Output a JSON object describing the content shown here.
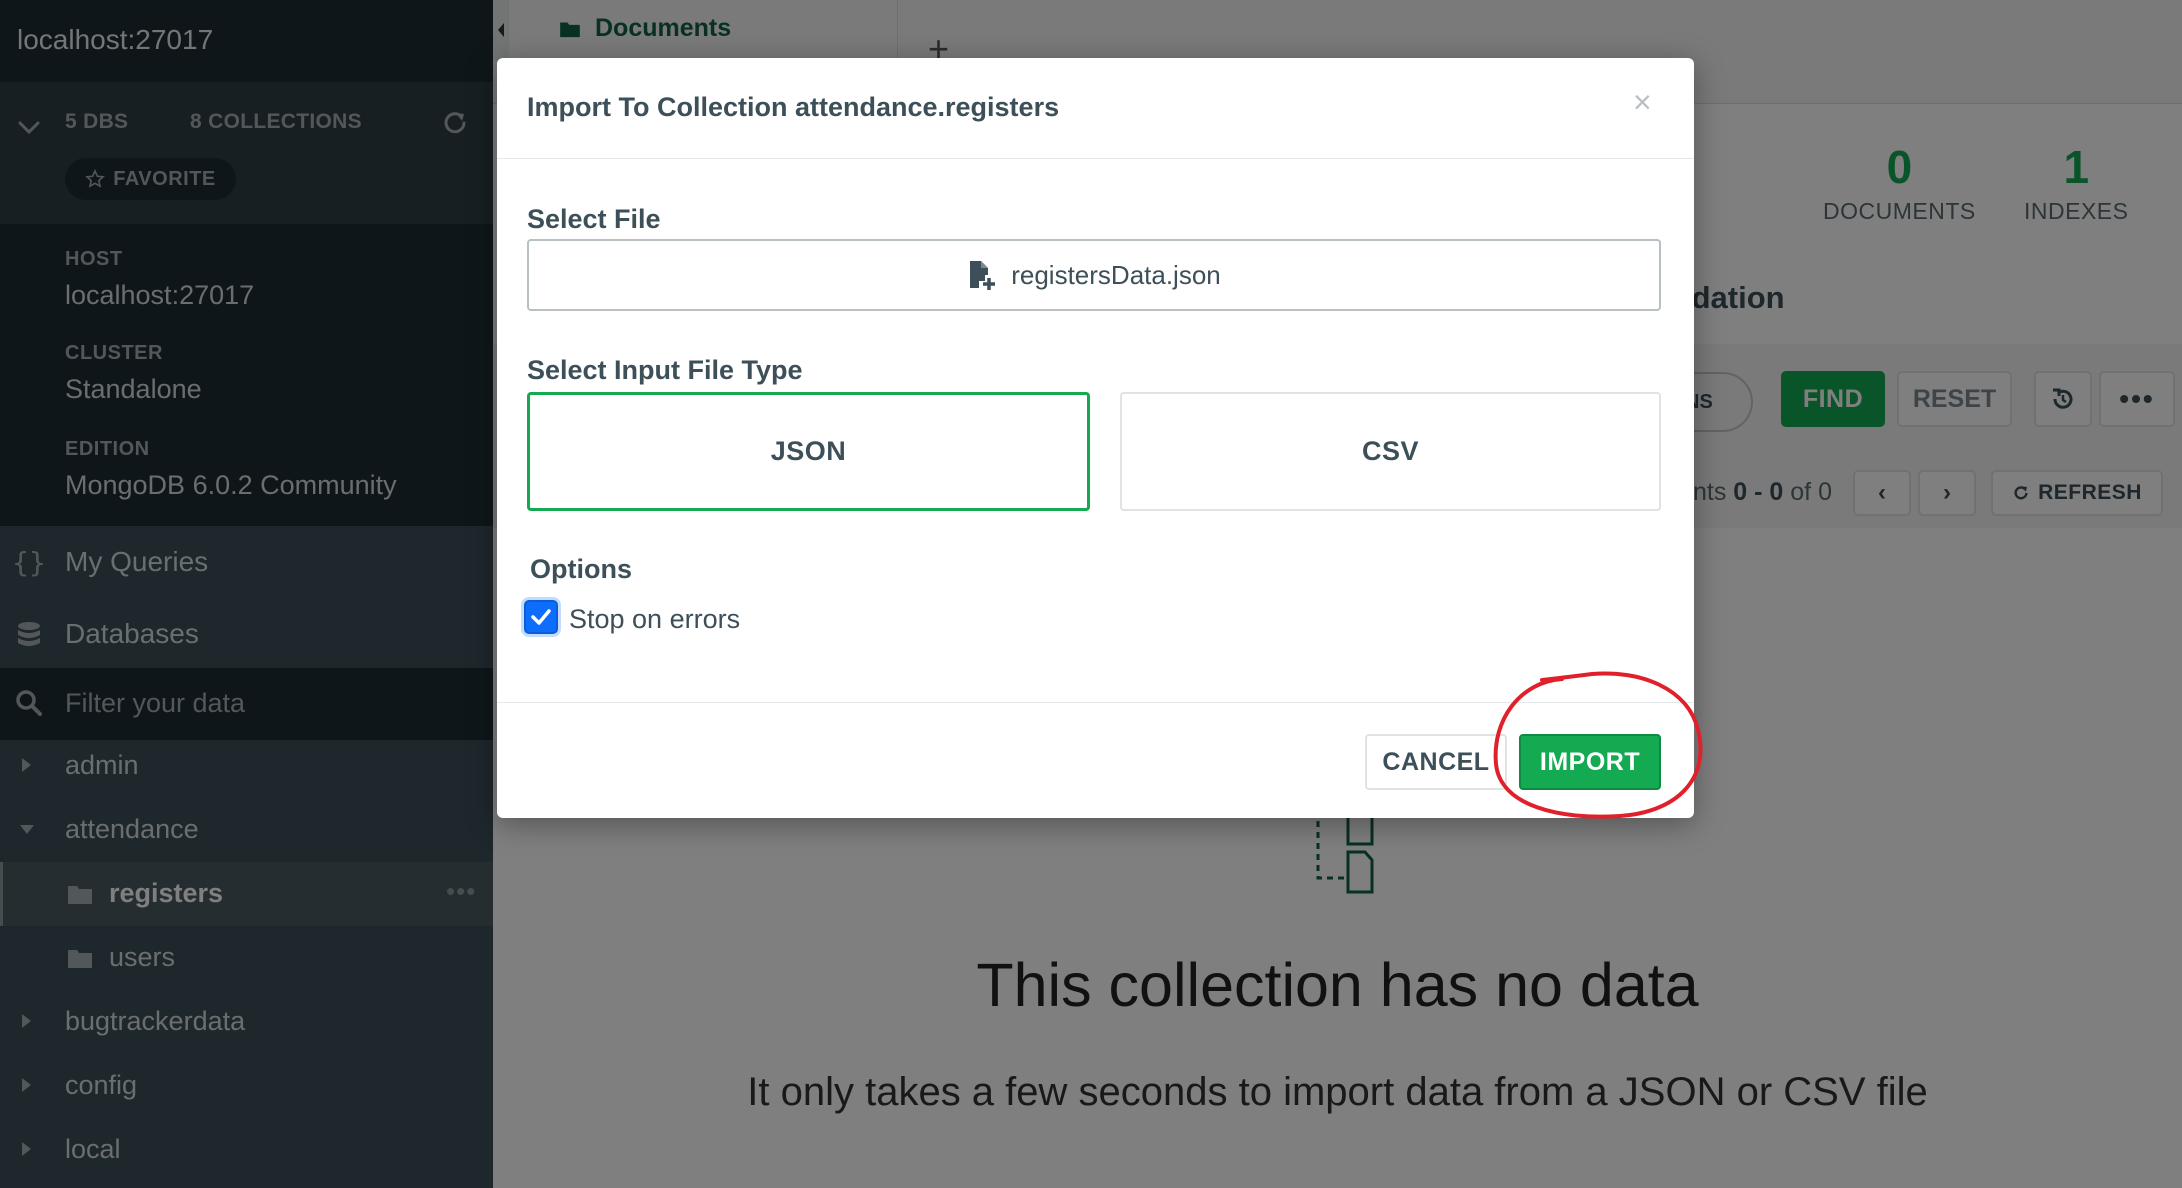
{
  "sidebar": {
    "connection": "localhost:27017",
    "dbs_count": "5",
    "dbs_label": "DBS",
    "collections_count": "8",
    "collections_label": "COLLECTIONS",
    "favorite_label": "FAVORITE",
    "host_label": "HOST",
    "host_value": "localhost:27017",
    "cluster_label": "CLUSTER",
    "cluster_value": "Standalone",
    "edition_label": "EDITION",
    "edition_value": "MongoDB 6.0.2 Community",
    "nav": [
      {
        "label": "My Queries",
        "icon": "braces-icon"
      },
      {
        "label": "Databases",
        "icon": "database-icon"
      }
    ],
    "filter_placeholder": "Filter your data",
    "tree": [
      {
        "label": "admin",
        "expanded": false
      },
      {
        "label": "attendance",
        "expanded": true,
        "children": [
          "registers",
          "users"
        ]
      },
      {
        "label": "bugtrackerdata",
        "expanded": false
      },
      {
        "label": "config",
        "expanded": false
      },
      {
        "label": "local",
        "expanded": false
      }
    ],
    "active_collection": "registers",
    "more_dots": "•••"
  },
  "main": {
    "tab_label": "Documents",
    "add_tab": "+",
    "documents_count": "0",
    "documents_label": "DOCUMENTS",
    "indexes_count": "1",
    "indexes_label": "INDEXES",
    "validation_fragment": "idation",
    "options_fragment": "NS",
    "find_label": "FIND",
    "reset_label": "RESET",
    "more_label": "•••",
    "pager_prefix": "nts ",
    "pager_range": "0 - 0",
    "pager_of": " of 0",
    "prev_label": "‹",
    "next_label": "›",
    "refresh_label": "REFRESH",
    "empty_title": "This collection has no data",
    "empty_subtitle": "It only takes a few seconds to import data from a JSON or CSV file"
  },
  "modal": {
    "title": "Import To Collection attendance.registers",
    "close": "×",
    "select_file_label": "Select File",
    "file_name": "registersData.json",
    "select_type_label": "Select Input File Type",
    "types": [
      "JSON",
      "CSV"
    ],
    "selected_type": "JSON",
    "options_label": "Options",
    "stop_on_errors_label": "Stop on errors",
    "stop_on_errors_checked": true,
    "cancel_label": "CANCEL",
    "import_label": "IMPORT"
  },
  "colors": {
    "accent_green": "#13aa52",
    "sidebar_bg": "#3d4f58",
    "annotation_red": "#e0202a"
  }
}
